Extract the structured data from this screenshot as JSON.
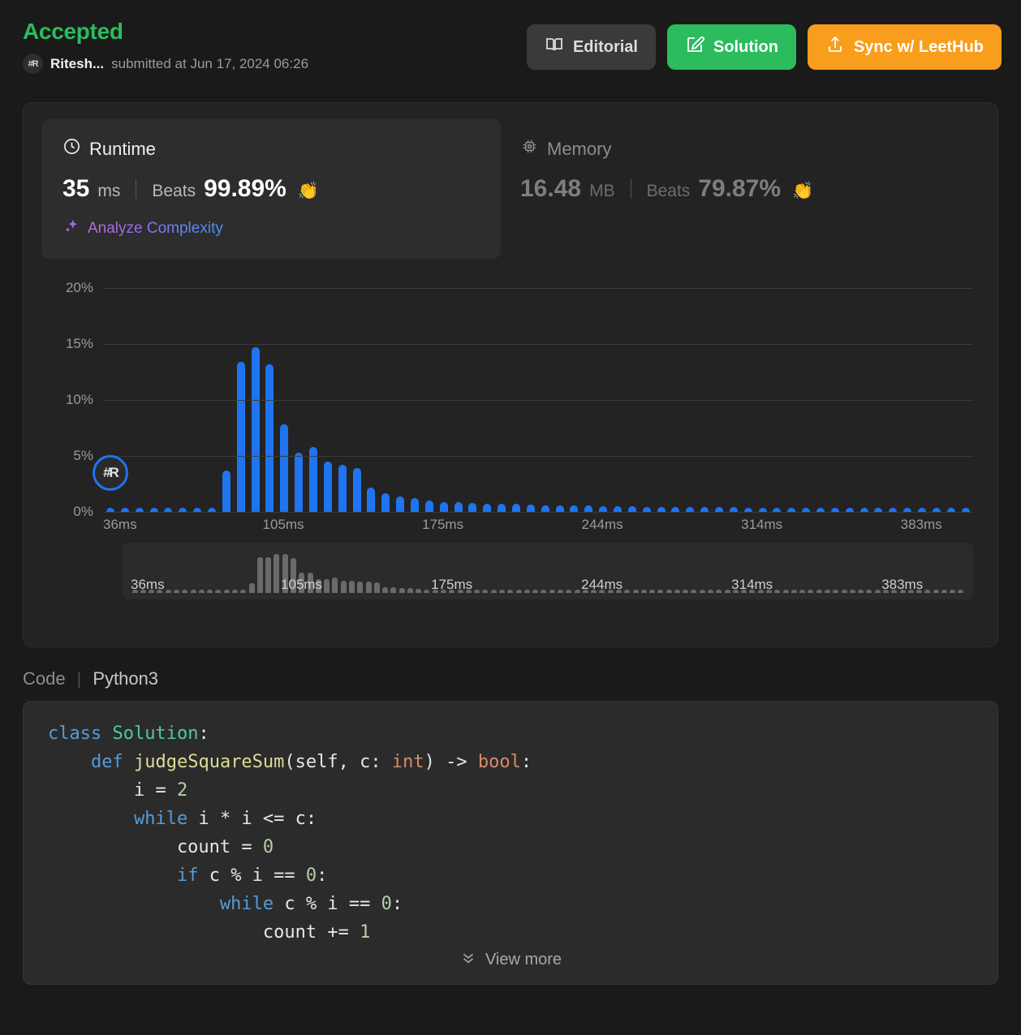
{
  "header": {
    "status": "Accepted",
    "avatar_initials": "#R",
    "username": "Ritesh...",
    "submitted_at": "submitted at Jun 17, 2024 06:26",
    "status_color": "#2cbb5d",
    "buttons": [
      {
        "label": "Editorial",
        "icon": "book-icon",
        "color": "#3a3a3a"
      },
      {
        "label": "Solution",
        "icon": "edit-icon",
        "color": "#2cbb5d"
      },
      {
        "label": "Sync w/ LeetHub",
        "icon": "upload-icon",
        "color": "#f99d1c"
      }
    ]
  },
  "stats": {
    "runtime": {
      "title": "Runtime",
      "icon": "clock-icon",
      "value": "35",
      "unit": "ms",
      "beats_label": "Beats",
      "beats_value": "99.89%",
      "emoji": "👏",
      "analyze_label": "Analyze Complexity",
      "analyze_icon": "sparkle-icon"
    },
    "memory": {
      "title": "Memory",
      "icon": "chip-icon",
      "value": "16.48",
      "unit": "MB",
      "beats_label": "Beats",
      "beats_value": "79.87%",
      "emoji": "👏"
    }
  },
  "chart_data": {
    "type": "bar",
    "title": "",
    "xlabel": "",
    "ylabel": "",
    "ylim": [
      0,
      21
    ],
    "grid": true,
    "bar_color": "#1f74f0",
    "ytick_labels": [
      "0%",
      "5%",
      "10%",
      "15%",
      "20%"
    ],
    "ytick_values": [
      0,
      5,
      10,
      15,
      20
    ],
    "xtick_labels": [
      "36ms",
      "105ms",
      "175ms",
      "244ms",
      "314ms",
      "383ms"
    ],
    "xtick_positions": [
      0,
      11,
      22,
      33,
      44,
      55
    ],
    "marker": {
      "label": "#R",
      "x_index": 0,
      "y_value": 3.5
    },
    "values": [
      0.35,
      0.3,
      0.35,
      0.3,
      0.35,
      0.3,
      0.35,
      0.3,
      3.7,
      13.4,
      14.7,
      13.2,
      7.8,
      5.3,
      5.8,
      4.5,
      4.2,
      3.9,
      2.2,
      1.7,
      1.4,
      1.2,
      1.0,
      0.9,
      0.85,
      0.8,
      0.75,
      0.7,
      0.7,
      0.65,
      0.6,
      0.6,
      0.55,
      0.55,
      0.5,
      0.5,
      0.5,
      0.45,
      0.45,
      0.45,
      0.4,
      0.4,
      0.4,
      0.4,
      0.35,
      0.35,
      0.35,
      0.35,
      0.35,
      0.3,
      0.3,
      0.3,
      0.3,
      0.3,
      0.3,
      0.3,
      0.3,
      0.25,
      0.25,
      0.25
    ]
  },
  "brush": {
    "xtick_labels": [
      "36ms",
      "105ms",
      "175ms",
      "244ms",
      "314ms",
      "383ms"
    ],
    "xtick_positions": [
      0,
      18,
      36,
      54,
      72,
      90
    ],
    "bar_color": "#6a6a6a"
  },
  "code": {
    "section_label": "Code",
    "separator": "|",
    "language": "Python3",
    "view_more_label": "View more",
    "view_more_icon": "chevron-double-down-icon",
    "text": "class Solution:\n    def judgeSquareSum(self, c: int) -> bool:\n        i = 2\n        while i * i <= c:\n            count = 0\n            if c % i == 0:\n                while c % i == 0:\n                    count += 1"
  }
}
